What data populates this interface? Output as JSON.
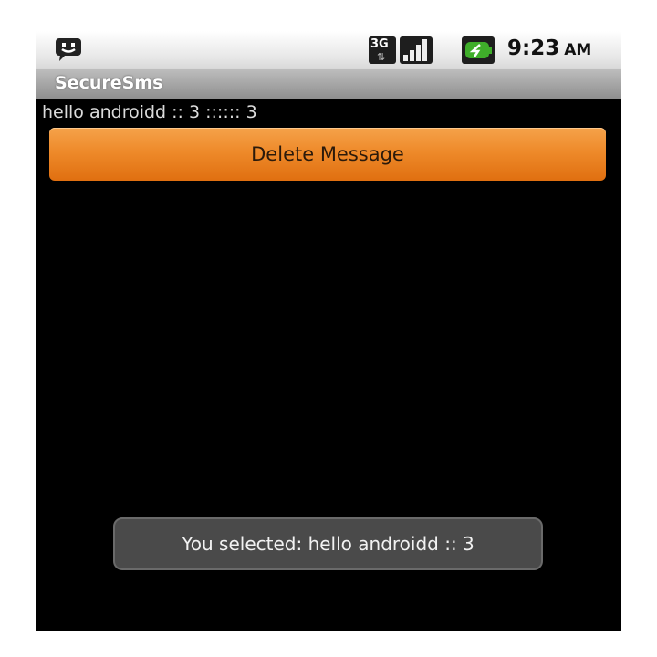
{
  "status_bar": {
    "notification_icon": "sms-notification-icon",
    "network_icon": "3g-data-icon",
    "network_label": "3G",
    "signal_icon": "signal-strength-icon",
    "battery_icon": "battery-charging-icon",
    "time": "9:23",
    "ampm": "AM"
  },
  "app": {
    "title": "SecureSms"
  },
  "message": {
    "text": "hello androidd :: 3 :::::: 3"
  },
  "buttons": {
    "delete_label": "Delete Message"
  },
  "toast": {
    "text": "You selected: hello androidd :: 3"
  },
  "colors": {
    "button_orange": "#ee8a2a",
    "battery_green": "#3fae2a",
    "background": "#000000"
  }
}
